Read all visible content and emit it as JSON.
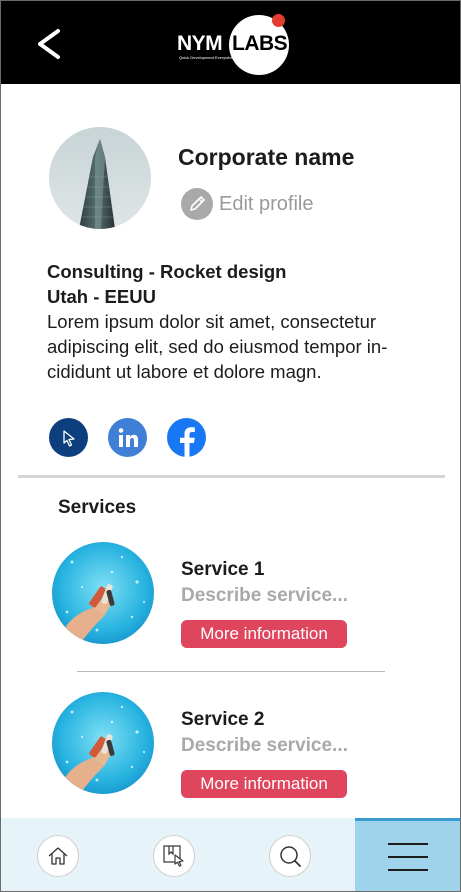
{
  "header": {
    "back_icon": "chevron-left-icon",
    "logo": {
      "part1": "NYM",
      "part2": "LABS",
      "tagline": "Quick Development Everywhere"
    }
  },
  "profile": {
    "name": "Corporate name",
    "edit_label": "Edit profile",
    "edit_icon": "pencil-icon",
    "headline": "Consulting - Rocket design",
    "location": "Utah - EEUU",
    "bio_lines": [
      "Lorem ipsum dolor sit amet, consectetur",
      "adipiscing elit, sed do eiusmod tempor in-",
      "cididunt ut labore et dolore magn."
    ]
  },
  "social": [
    {
      "name": "website-link",
      "icon": "cursor-icon",
      "color": "#0d3f7f"
    },
    {
      "name": "linkedin-link",
      "icon": "linkedin-icon",
      "color": "#3f7fd6"
    },
    {
      "name": "facebook-link",
      "icon": "facebook-icon",
      "color": "#1877f2"
    }
  ],
  "services": {
    "title": "Services",
    "items": [
      {
        "title": "Service 1",
        "description": "Describe service...",
        "button": "More information"
      },
      {
        "title": "Service 2",
        "description": "Describe service...",
        "button": "More information"
      }
    ]
  },
  "bottom_nav": {
    "items": [
      "home-icon",
      "bookmark-cursor-icon",
      "search-icon",
      "menu-icon"
    ]
  },
  "colors": {
    "header_bg": "#000000",
    "accent": "#e0455e",
    "nav_bg": "#e6f4f9",
    "nav_active": "#9fd3ec"
  }
}
